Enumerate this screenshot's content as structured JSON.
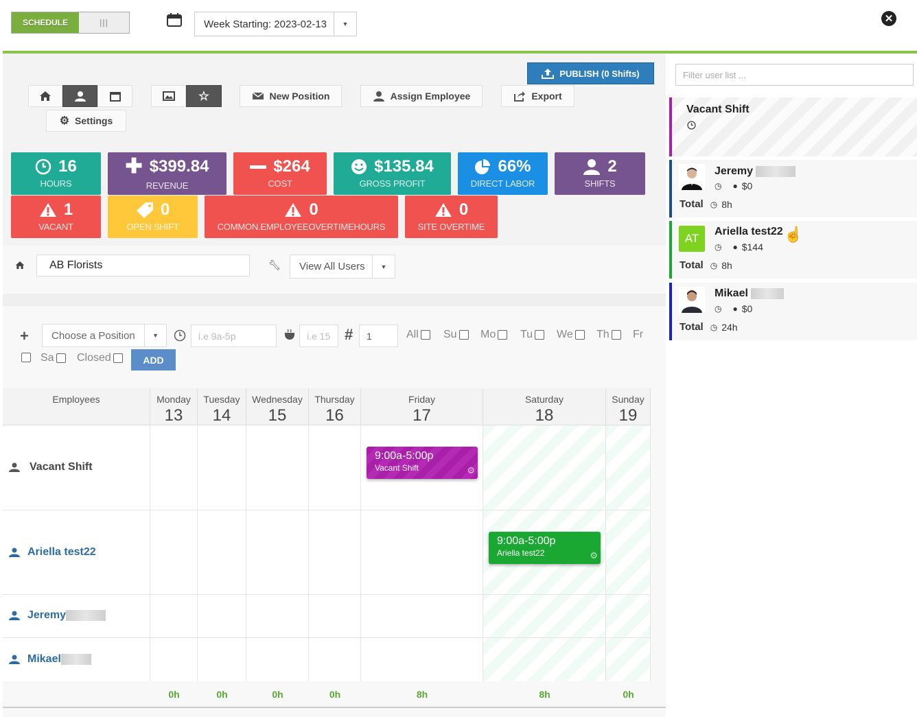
{
  "header": {
    "schedule_label": "SCHEDULE",
    "toggle_off_glyph": "|||",
    "week_label": "Week Starting: 2023-02-13",
    "close_glyph": "✕"
  },
  "toolbar": {
    "publish_label": "PUBLISH (0 Shifts)",
    "new_position": "New Position",
    "assign_employee": "Assign Employee",
    "export": "Export",
    "settings": "Settings"
  },
  "stats_row1": [
    {
      "value": "16",
      "label": "HOURS",
      "icon": "clock-icon",
      "color": "#1fab95"
    },
    {
      "value": "$399.84",
      "label": "REVENUE",
      "icon": "plus-icon",
      "color": "#75548f"
    },
    {
      "value": "$264",
      "label": "COST",
      "icon": "minus-icon",
      "color": "#f0534f"
    },
    {
      "value": "$135.84",
      "label": "GROSS PROFIT",
      "icon": "smile-icon",
      "color": "#1fab95"
    },
    {
      "value": "66%",
      "label": "DIRECT LABOR",
      "icon": "pie-icon",
      "color": "#1a8fe3"
    },
    {
      "value": "2",
      "label": "SHIFTS",
      "icon": "user-icon",
      "color": "#75548f"
    }
  ],
  "stats_row2": [
    {
      "value": "1",
      "label": "VACANT",
      "icon": "warning-icon",
      "color": "#f0534f"
    },
    {
      "value": "0",
      "label": "OPEN SHIFT",
      "icon": "tag-icon",
      "color": "#ffc83a"
    },
    {
      "value": "0",
      "label": "COMMON.EMPLOYEEOVERTIMEHOURS",
      "icon": "warning-icon",
      "color": "#f0534f"
    },
    {
      "value": "0",
      "label": "SITE OVERTIME",
      "icon": "warning-icon",
      "color": "#f0534f"
    }
  ],
  "filter": {
    "location": "AB Florists",
    "users_select": "View All Users"
  },
  "add_form": {
    "position_placeholder": "Choose a Position",
    "time_placeholder": "i.e 9a-5p",
    "break_placeholder": "i.e 15",
    "count_value": "1",
    "days": [
      "All",
      "Su",
      "Mo",
      "Tu",
      "We",
      "Th",
      "Fr",
      "Sa",
      "Closed"
    ],
    "add_label": "ADD"
  },
  "grid": {
    "employees_header": "Employees",
    "days": [
      {
        "name": "Monday",
        "num": "13",
        "total": "0h"
      },
      {
        "name": "Tuesday",
        "num": "14",
        "total": "0h"
      },
      {
        "name": "Wednesday",
        "num": "15",
        "total": "0h"
      },
      {
        "name": "Thursday",
        "num": "16",
        "total": "0h"
      },
      {
        "name": "Friday",
        "num": "17",
        "total": "8h"
      },
      {
        "name": "Saturday",
        "num": "18",
        "total": "8h"
      },
      {
        "name": "Sunday",
        "num": "19",
        "total": "0h"
      }
    ],
    "rows": [
      {
        "name": "Vacant Shift"
      },
      {
        "name": "Ariella test22"
      },
      {
        "name": "Jeremy"
      },
      {
        "name": "Mikael"
      }
    ],
    "shifts": [
      {
        "time": "9:00a-5:00p",
        "who": "Vacant Shift",
        "color": "#a81fa8"
      },
      {
        "time": "9:00a-5:00p",
        "who": "Ariella test22",
        "color": "#1aa832"
      }
    ]
  },
  "sidebar": {
    "filter_placeholder": "Filter user list ...",
    "vacant": {
      "name": "Vacant Shift",
      "color": "#a81fa8"
    },
    "users": [
      {
        "name": "Jeremy",
        "cost": "$0",
        "total_label": "Total",
        "total": "8h",
        "color": "#1b4f8a"
      },
      {
        "name": "Ariella test22",
        "initials": "AT",
        "cost": "$144",
        "total_label": "Total",
        "total": "8h",
        "color": "#1aa832"
      },
      {
        "name": "Mikael",
        "cost": "$0",
        "total_label": "Total",
        "total": "24h",
        "color": "#1a1fc8"
      }
    ]
  }
}
